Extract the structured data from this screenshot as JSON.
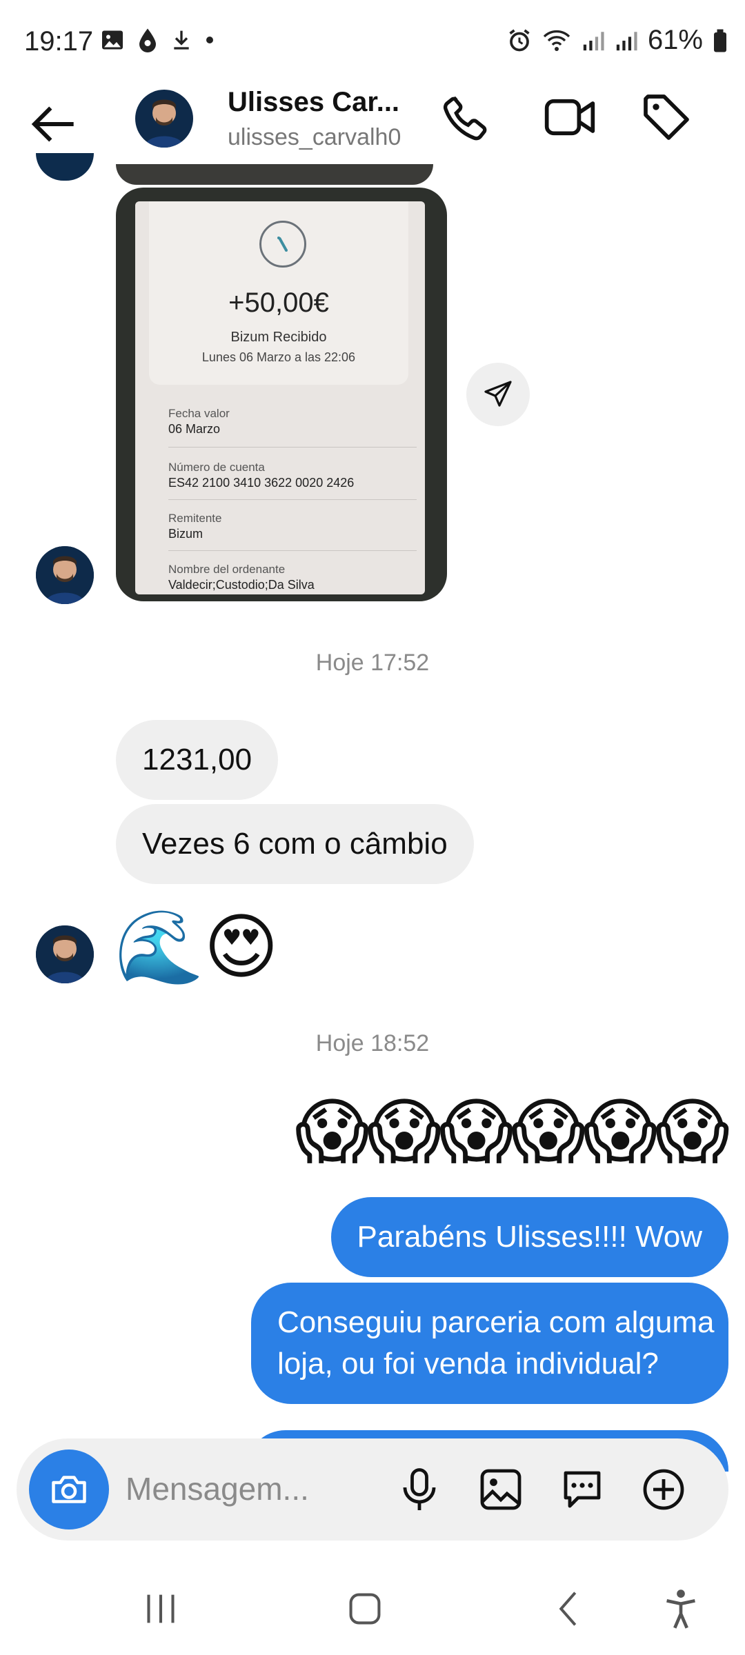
{
  "status": {
    "time": "19:17",
    "battery": "61%"
  },
  "header": {
    "name": "Ulisses Car...",
    "username": "ulisses_carvalh0"
  },
  "receipt": {
    "amount": "+50,00€",
    "title": "Bizum Recibido",
    "date": "Lunes 06 Marzo a las 22:06",
    "fields": [
      {
        "label": "Fecha valor",
        "value": "06 Marzo"
      },
      {
        "label": "Número de cuenta",
        "value": "ES42 2100 3410 3622 0020 2426"
      },
      {
        "label": "Remitente",
        "value": "Bizum"
      },
      {
        "label": "Nombre del ordenante",
        "value": "Valdecir;Custodio;Da Silva"
      }
    ]
  },
  "messages": {
    "ts1": "Hoje 17:52",
    "in1": "1231,00",
    "in2": "Vezes 6 com o câmbio",
    "emoji_in": "🌊😍",
    "ts2": "Hoje 18:52",
    "emoji_out": "😱😱😱😱😱😱",
    "out1": "Parabéns Ulisses!!!! Wow",
    "out2_line1": "Conseguiu parceria com alguma",
    "out2_line2": "loja, ou foi venda individual?"
  },
  "composer": {
    "placeholder": "Mensagem..."
  },
  "colors": {
    "accent": "#2b80e6",
    "incoming_bubble": "#efefef"
  }
}
